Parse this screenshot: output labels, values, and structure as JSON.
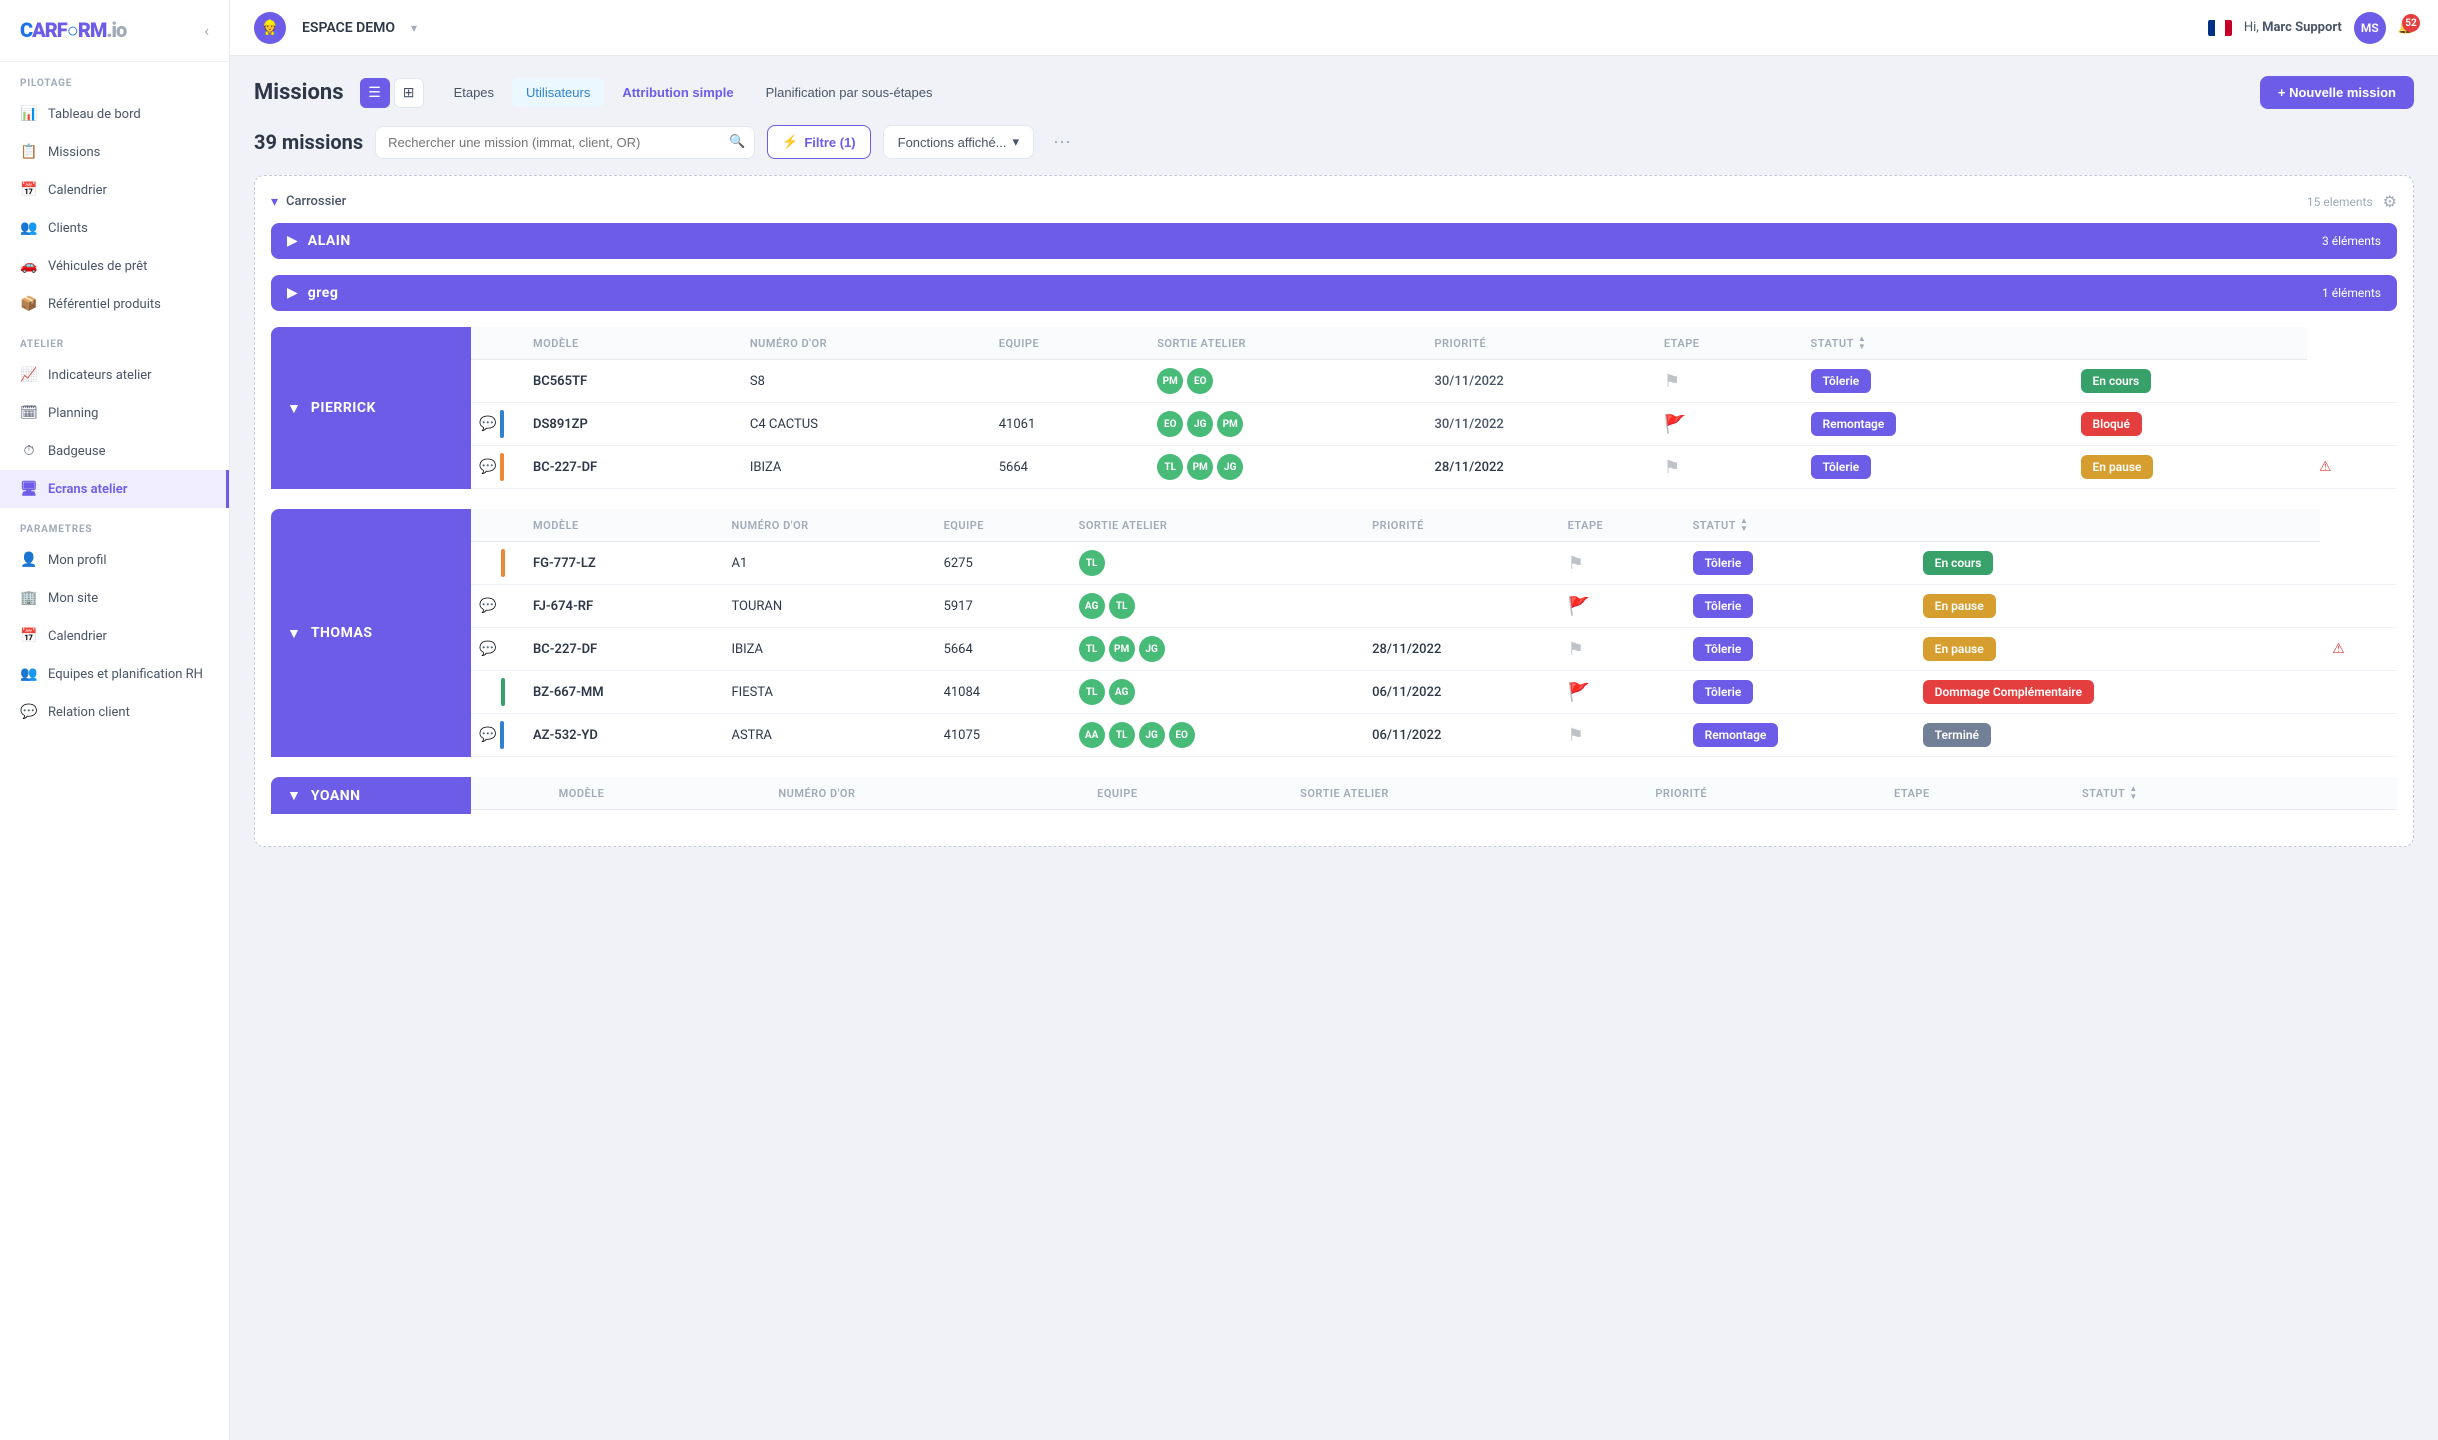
{
  "logo": {
    "text1": "C",
    "text2": "ARF",
    "text3": "RM.io"
  },
  "topbar": {
    "workspace": "ESPACE DEMO",
    "hi_text": "Hi,",
    "user_name": "Marc Support",
    "user_initials": "MS",
    "notif_count": "52"
  },
  "sidebar": {
    "sections": [
      {
        "title": "PILOTAGE",
        "items": [
          {
            "id": "tableau-de-bord",
            "label": "Tableau de bord",
            "icon": "📊"
          },
          {
            "id": "missions",
            "label": "Missions",
            "icon": "📋"
          },
          {
            "id": "calendrier",
            "label": "Calendrier",
            "icon": "📅"
          },
          {
            "id": "clients",
            "label": "Clients",
            "icon": "👥"
          },
          {
            "id": "vehicules",
            "label": "Véhicules de prêt",
            "icon": "🚗"
          },
          {
            "id": "referentiel",
            "label": "Référentiel produits",
            "icon": "📦"
          }
        ]
      },
      {
        "title": "ATELIER",
        "items": [
          {
            "id": "indicateurs",
            "label": "Indicateurs atelier",
            "icon": "📈"
          },
          {
            "id": "planning",
            "label": "Planning",
            "icon": "🗓"
          },
          {
            "id": "badgeuse",
            "label": "Badgeuse",
            "icon": "⏱"
          },
          {
            "id": "ecrans",
            "label": "Ecrans atelier",
            "icon": "🖥",
            "active": true
          }
        ]
      },
      {
        "title": "PARAMETRES",
        "items": [
          {
            "id": "mon-profil",
            "label": "Mon profil",
            "icon": "👤"
          },
          {
            "id": "mon-site",
            "label": "Mon site",
            "icon": "🏢"
          },
          {
            "id": "calendrier2",
            "label": "Calendrier",
            "icon": "📅"
          },
          {
            "id": "equipes",
            "label": "Equipes et planification RH",
            "icon": "👥"
          },
          {
            "id": "relation",
            "label": "Relation client",
            "icon": "💬"
          }
        ]
      }
    ]
  },
  "page": {
    "title": "Missions",
    "mission_count": "39 missions",
    "search_placeholder": "Rechercher une mission (immat, client, OR)",
    "tabs": [
      {
        "id": "etapes",
        "label": "Etapes",
        "active": false
      },
      {
        "id": "utilisateurs",
        "label": "Utilisateurs",
        "active": true
      },
      {
        "id": "attribution",
        "label": "Attribution simple",
        "active": true
      },
      {
        "id": "planification",
        "label": "Planification par sous-étapes",
        "active": false
      }
    ],
    "filter_btn": "Filtre (1)",
    "fonctions_btn": "Fonctions affiché...",
    "new_mission_btn": "+ Nouvelle mission"
  },
  "section": {
    "name": "Carrossier",
    "count": "15 elements",
    "groups": [
      {
        "name": "ALAIN",
        "count": "3 éléments",
        "expanded": false,
        "rows": []
      },
      {
        "name": "greg",
        "count": "1 éléments",
        "expanded": false,
        "rows": []
      },
      {
        "name": "PIERRICK",
        "expanded": true,
        "columns": [
          "Modèle",
          "Numéro d'OR",
          "Equipe",
          "Sortie atelier",
          "Priorité",
          "Etape",
          "Statut"
        ],
        "rows": [
          {
            "immat": "BC565TF",
            "modele": "S8",
            "or": "",
            "equipe": [
              "PM",
              "EO"
            ],
            "sortie": "30/11/2022",
            "sortie_late": false,
            "priorite": "grey",
            "etape": "Tôlerie",
            "statut": "En cours",
            "statut_class": "statut-en-cours",
            "has_comment": false,
            "color_bar": "empty",
            "has_alert": false
          },
          {
            "immat": "DS891ZP",
            "modele": "C4 CACTUS",
            "or": "41061",
            "equipe": [
              "EO",
              "JG",
              "PM"
            ],
            "sortie": "30/11/2022",
            "sortie_late": false,
            "priorite": "yellow",
            "etape": "Remontage",
            "statut": "Bloqué",
            "statut_class": "statut-bloque",
            "has_comment": true,
            "color_bar": "blue",
            "has_alert": false
          },
          {
            "immat": "BC-227-DF",
            "modele": "IBIZA",
            "or": "5664",
            "equipe": [
              "TL",
              "PM",
              "JG"
            ],
            "sortie": "28/11/2022",
            "sortie_late": true,
            "priorite": "grey",
            "etape": "Tôlerie",
            "statut": "En pause",
            "statut_class": "statut-en-pause",
            "has_comment": true,
            "color_bar": "orange",
            "has_alert": true
          }
        ]
      },
      {
        "name": "THOMAS",
        "expanded": true,
        "columns": [
          "Modèle",
          "Numéro d'OR",
          "Equipe",
          "Sortie atelier",
          "Priorité",
          "Etape",
          "Statut"
        ],
        "rows": [
          {
            "immat": "FG-777-LZ",
            "modele": "A1",
            "or": "6275",
            "equipe": [
              "TL"
            ],
            "sortie": "",
            "sortie_late": false,
            "priorite": "grey",
            "etape": "Tôlerie",
            "statut": "En cours",
            "statut_class": "statut-en-cours",
            "has_comment": false,
            "color_bar": "orange",
            "has_alert": false
          },
          {
            "immat": "FJ-674-RF",
            "modele": "TOURAN",
            "or": "5917",
            "equipe": [
              "AG",
              "TL"
            ],
            "sortie": "",
            "sortie_late": false,
            "priorite": "yellow",
            "etape": "Tôlerie",
            "statut": "En pause",
            "statut_class": "statut-en-pause",
            "has_comment": true,
            "color_bar": "empty",
            "has_alert": false
          },
          {
            "immat": "BC-227-DF",
            "modele": "IBIZA",
            "or": "5664",
            "equipe": [
              "TL",
              "PM",
              "JG"
            ],
            "sortie": "28/11/2022",
            "sortie_late": true,
            "priorite": "grey",
            "etape": "Tôlerie",
            "statut": "En pause",
            "statut_class": "statut-en-pause",
            "has_comment": true,
            "color_bar": "empty",
            "has_alert": true
          },
          {
            "immat": "BZ-667-MM",
            "modele": "FIESTA",
            "or": "41084",
            "equipe": [
              "TL",
              "AG"
            ],
            "sortie": "06/11/2022",
            "sortie_late": true,
            "priorite": "yellow",
            "etape": "Tôlerie",
            "statut": "Dommage Complémentaire",
            "statut_class": "statut-dommage",
            "has_comment": false,
            "color_bar": "green",
            "has_alert": false
          },
          {
            "immat": "AZ-532-YD",
            "modele": "ASTRA",
            "or": "41075",
            "equipe": [
              "AA",
              "TL",
              "JG",
              "EO"
            ],
            "sortie": "06/11/2022",
            "sortie_late": true,
            "priorite": "grey",
            "etape": "Remontage",
            "statut": "Terminé",
            "statut_class": "statut-termine",
            "has_comment": true,
            "color_bar": "blue",
            "has_alert": false
          }
        ]
      },
      {
        "name": "YOANN",
        "expanded": false,
        "columns": [
          "Modèle",
          "Numéro d'OR",
          "Equipe",
          "Sortie atelier",
          "Priorité",
          "Etape",
          "Statut"
        ],
        "rows": []
      }
    ]
  },
  "avatar_colors": {
    "PM": "#48bb78",
    "EO": "#48bb78",
    "JG": "#48bb78",
    "TL": "#48bb78",
    "AG": "#48bb78",
    "AA": "#48bb78"
  }
}
